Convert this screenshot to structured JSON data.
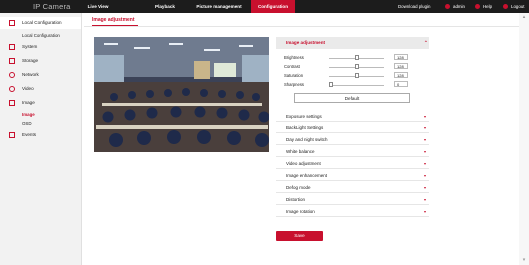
{
  "brand": "IP Camera",
  "nav": {
    "tabs": [
      {
        "label": "Live View"
      },
      {
        "label": "Playback"
      },
      {
        "label": "Picture management"
      },
      {
        "label": "Configuration"
      }
    ],
    "download_plugin": "Download plugin",
    "user": "admin",
    "help": "Help",
    "logout": "Logout"
  },
  "sidebar": {
    "items": [
      {
        "label": "Local Configuration",
        "icon": "monitor-icon"
      },
      {
        "label": "Local Configuration"
      },
      {
        "label": "System",
        "icon": "system-icon"
      },
      {
        "label": "Storage",
        "icon": "storage-icon"
      },
      {
        "label": "Network",
        "icon": "network-icon"
      },
      {
        "label": "Video",
        "icon": "video-icon"
      },
      {
        "label": "Image",
        "icon": "image-icon"
      },
      {
        "label": "Image"
      },
      {
        "label": "OSD"
      },
      {
        "label": "Events",
        "icon": "events-icon"
      }
    ]
  },
  "page": {
    "title": "Image adjustment"
  },
  "panel": {
    "heading": "Image adjustment",
    "sliders": [
      {
        "label": "Brightness",
        "value": "128",
        "level": 0.5
      },
      {
        "label": "Contrast",
        "value": "128",
        "level": 0.5
      },
      {
        "label": "Saturation",
        "value": "128",
        "level": 0.5
      },
      {
        "label": "Sharpness",
        "value": "0",
        "level": 0.0
      }
    ],
    "default_label": "Default",
    "sections": [
      {
        "label": "Exposure settings"
      },
      {
        "label": "BackLight Settings"
      },
      {
        "label": "Day and night switch"
      },
      {
        "label": "White balance"
      },
      {
        "label": "Video adjustment"
      },
      {
        "label": "Image enhancement"
      },
      {
        "label": "Defog mode"
      },
      {
        "label": "Distortion"
      },
      {
        "label": "Image rotation"
      }
    ]
  },
  "save_label": "Save",
  "colors": {
    "accent": "#c8102e",
    "topbar": "#1c1c1c"
  }
}
